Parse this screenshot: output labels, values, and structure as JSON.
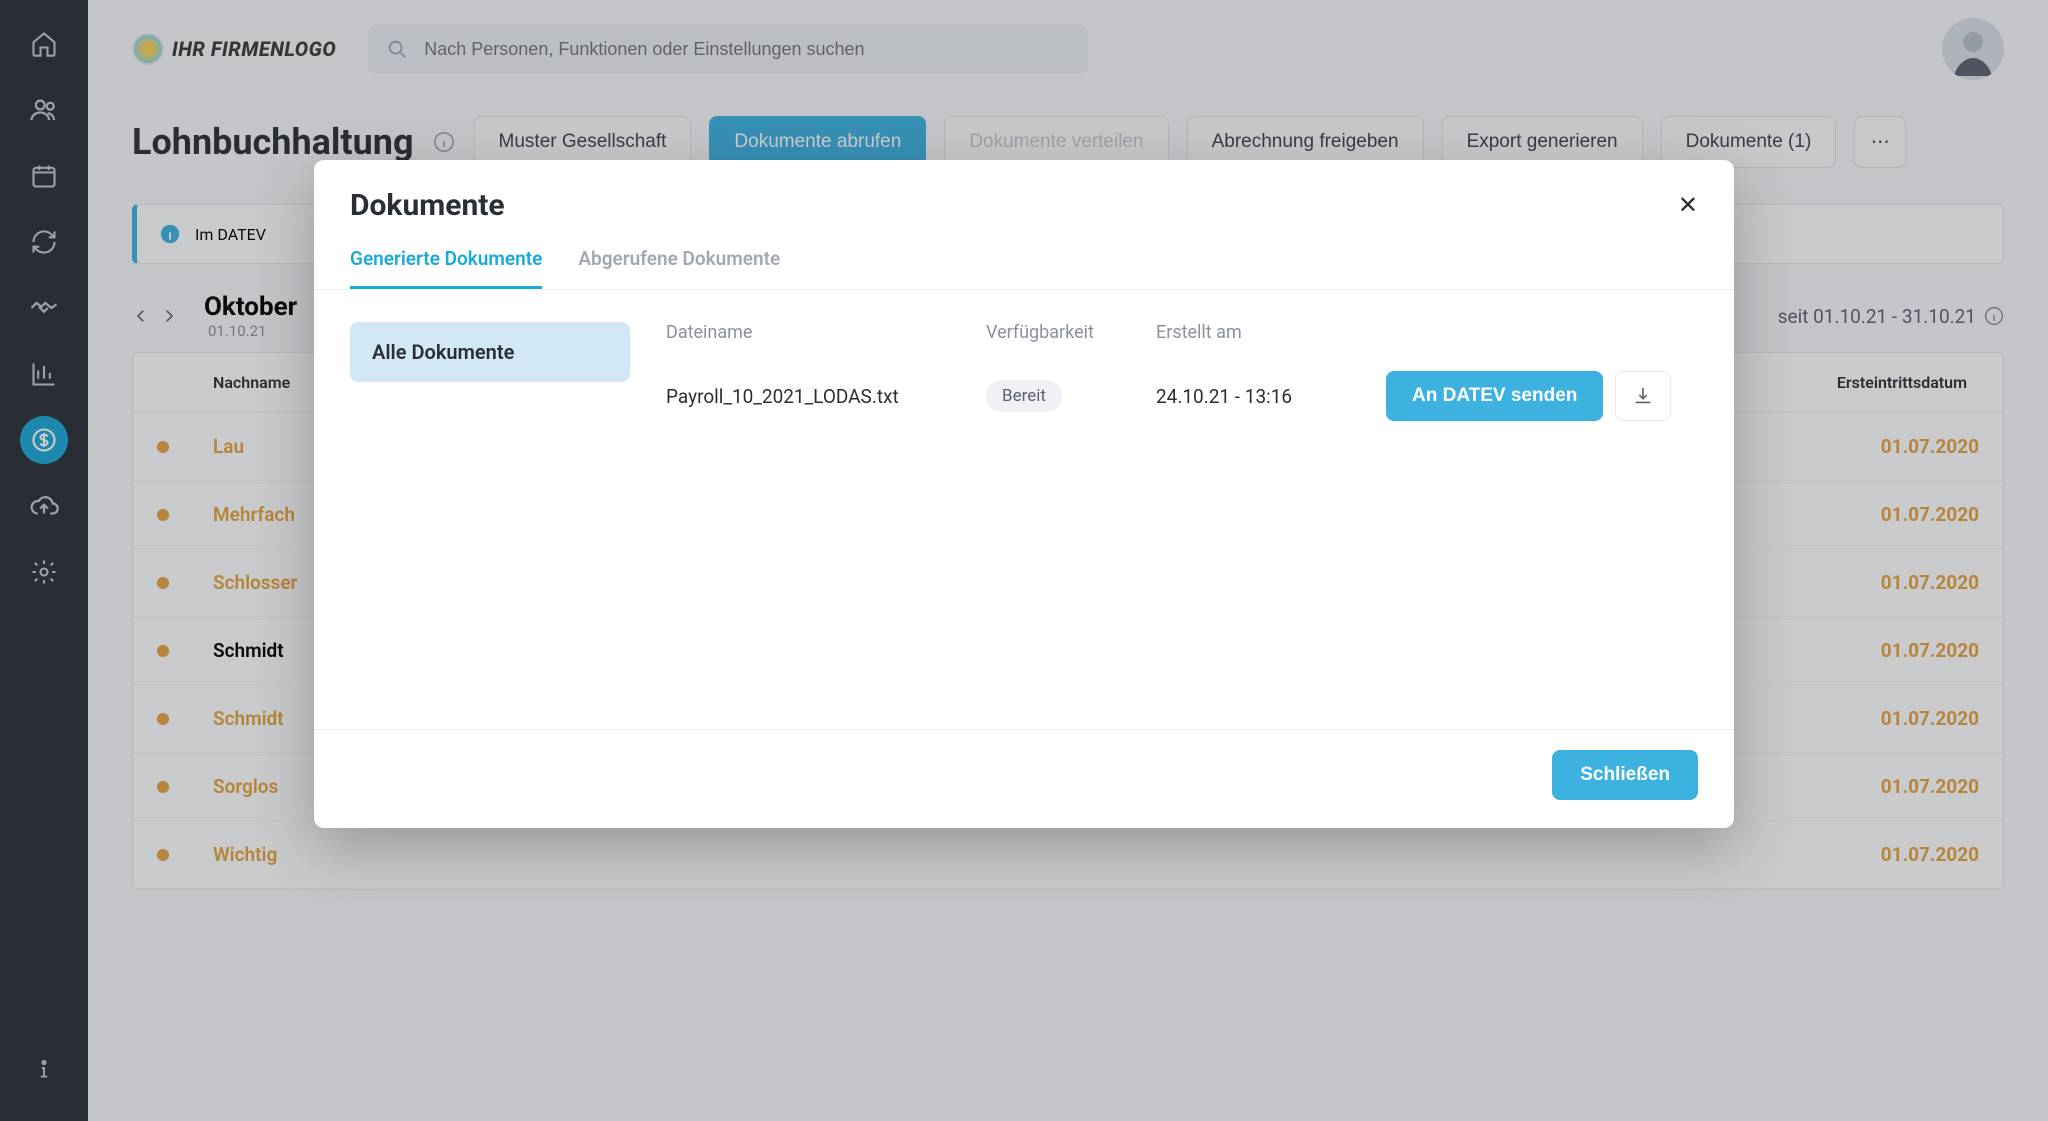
{
  "header": {
    "logo_text": "IHR FIRMENLOGO",
    "search_placeholder": "Nach Personen, Funktionen oder Einstellungen suchen"
  },
  "page": {
    "title": "Lohnbuchhaltung",
    "company_selector": "Muster Gesellschaft",
    "actions": {
      "fetch_docs": "Dokumente abrufen",
      "distribute_docs": "Dokumente verteilen",
      "release_payroll": "Abrechnung freigeben",
      "export_generate": "Export generieren",
      "documents_count": "Dokumente (1)"
    },
    "banner_prefix": "Im DATEV",
    "month": {
      "label": "Oktober",
      "range_short": "01.10.21",
      "range_right": "seit 01.10.21 - 31.10.21"
    },
    "table": {
      "col_name": "Nachname",
      "col_date": "Ersteintrittsdatum",
      "rows": [
        {
          "name": "Lau",
          "highlight": true,
          "date": "01.07.2020"
        },
        {
          "name": "Mehrfach",
          "highlight": true,
          "date": "01.07.2020"
        },
        {
          "name": "Schlosser",
          "highlight": true,
          "date": "01.07.2020"
        },
        {
          "name": "Schmidt",
          "highlight": false,
          "date": "01.07.2020"
        },
        {
          "name": "Schmidt",
          "highlight": true,
          "date": "01.07.2020"
        },
        {
          "name": "Sorglos",
          "highlight": true,
          "date": "01.07.2020"
        },
        {
          "name": "Wichtig",
          "highlight": true,
          "date": "01.07.2020"
        }
      ]
    }
  },
  "modal": {
    "title": "Dokumente",
    "tabs": {
      "generated": "Generierte Dokumente",
      "fetched": "Abgerufene Dokumente"
    },
    "side_all": "Alle Dokumente",
    "columns": {
      "filename": "Dateiname",
      "availability": "Verfügbarkeit",
      "created": "Erstellt am"
    },
    "row": {
      "filename": "Payroll_10_2021_LODAS.txt",
      "status": "Bereit",
      "created": "24.10.21 - 13:16",
      "send_label": "An DATEV senden"
    },
    "close_label": "Schließen"
  }
}
